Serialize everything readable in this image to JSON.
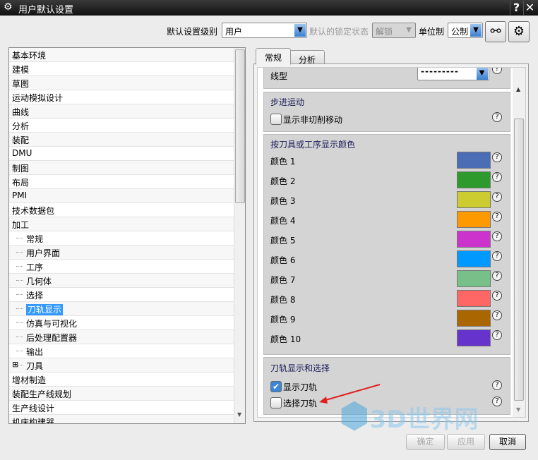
{
  "window": {
    "title": "用户默认设置",
    "help": "?",
    "close": "✕"
  },
  "toolbar": {
    "level_label": "默认设置级别",
    "level_value": "用户",
    "lock_label": "默认的锁定状态",
    "lock_value": "解锁",
    "unit_label": "单位制",
    "unit_value": "公制"
  },
  "tree": {
    "items": [
      {
        "label": "基本环境"
      },
      {
        "label": "建模"
      },
      {
        "label": "草图"
      },
      {
        "label": "运动模拟设计"
      },
      {
        "label": "曲线"
      },
      {
        "label": "分析"
      },
      {
        "label": "装配"
      },
      {
        "label": "DMU"
      },
      {
        "label": "制图"
      },
      {
        "label": "布局"
      },
      {
        "label": "PMI"
      },
      {
        "label": "技术数据包"
      },
      {
        "label": "加工"
      },
      {
        "label": "常规",
        "sub": true
      },
      {
        "label": "用户界面",
        "sub": true
      },
      {
        "label": "工序",
        "sub": true
      },
      {
        "label": "几何体",
        "sub": true
      },
      {
        "label": "选择",
        "sub": true
      },
      {
        "label": "刀轨显示",
        "sub": true,
        "selected": true
      },
      {
        "label": "仿真与可视化",
        "sub": true
      },
      {
        "label": "后处理配置器",
        "sub": true
      },
      {
        "label": "输出",
        "sub": true
      },
      {
        "label": "刀具",
        "sub": true,
        "expand": "+"
      },
      {
        "label": "增材制造"
      },
      {
        "label": "装配生产线规划"
      },
      {
        "label": "生产线设计"
      },
      {
        "label": "机床构建器"
      }
    ]
  },
  "tabs": [
    {
      "label": "常规",
      "active": true
    },
    {
      "label": "分析"
    }
  ],
  "linetype": {
    "label": "线型",
    "value": "---------"
  },
  "step": {
    "title": "步进运动",
    "option": "显示非切削移动",
    "checked": false
  },
  "colors": {
    "title": "按刀具或工序显示颜色",
    "items": [
      {
        "label": "颜色 1",
        "color": "#4a6db5"
      },
      {
        "label": "颜色 2",
        "color": "#2e9a2e"
      },
      {
        "label": "颜色 3",
        "color": "#cccc30"
      },
      {
        "label": "颜色 4",
        "color": "#ff9900"
      },
      {
        "label": "颜色 5",
        "color": "#cc33cc"
      },
      {
        "label": "颜色 6",
        "color": "#0099ff"
      },
      {
        "label": "颜色 7",
        "color": "#77c08a"
      },
      {
        "label": "颜色 8",
        "color": "#ff6666"
      },
      {
        "label": "颜色 9",
        "color": "#aa6600"
      },
      {
        "label": "颜色 10",
        "color": "#6633cc"
      }
    ]
  },
  "toolpath": {
    "title": "刀轨显示和选择",
    "options": [
      {
        "label": "显示刀轨",
        "checked": true
      },
      {
        "label": "选择刀轨",
        "checked": false
      }
    ]
  },
  "buttons": {
    "ok": "确定",
    "apply": "应用",
    "cancel": "取消"
  },
  "watermark": "3D世界网"
}
